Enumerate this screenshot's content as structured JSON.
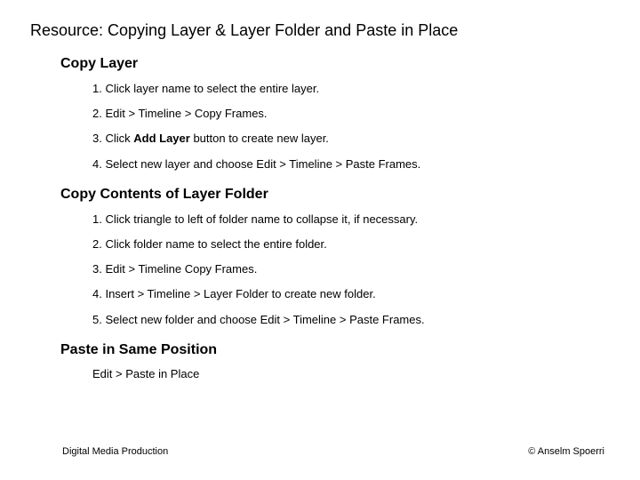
{
  "title": "Resource: Copying Layer & Layer Folder and Paste in Place",
  "sections": {
    "copy_layer": {
      "heading": "Copy Layer",
      "steps": [
        {
          "n": "1.",
          "pre": "Click layer name to select the entire layer.",
          "bold": "",
          "post": ""
        },
        {
          "n": "2.",
          "pre": "Edit > Timeline > Copy Frames.",
          "bold": "",
          "post": ""
        },
        {
          "n": "3.",
          "pre": "Click ",
          "bold": "Add Layer",
          "post": " button to create new layer."
        },
        {
          "n": "4.",
          "pre": "Select new layer and choose Edit > Timeline > Paste Frames.",
          "bold": "",
          "post": ""
        }
      ]
    },
    "copy_folder": {
      "heading": "Copy Contents of Layer Folder",
      "steps": [
        {
          "n": "1.",
          "pre": "Click triangle to left of folder name to collapse it, if necessary.",
          "bold": "",
          "post": ""
        },
        {
          "n": "2.",
          "pre": "Click folder name to select the entire folder.",
          "bold": "",
          "post": ""
        },
        {
          "n": "3.",
          "pre": "Edit > Timeline Copy Frames.",
          "bold": "",
          "post": ""
        },
        {
          "n": "4.",
          "pre": "Insert > Timeline > Layer Folder to create new folder.",
          "bold": "",
          "post": ""
        },
        {
          "n": "5.",
          "pre": "Select new folder and choose Edit > Timeline > Paste Frames.",
          "bold": "",
          "post": ""
        }
      ]
    },
    "paste_same": {
      "heading": "Paste in Same Position",
      "body": "Edit > Paste in Place"
    }
  },
  "footer": {
    "left": "Digital Media Production",
    "right": "© Anselm Spoerri"
  }
}
